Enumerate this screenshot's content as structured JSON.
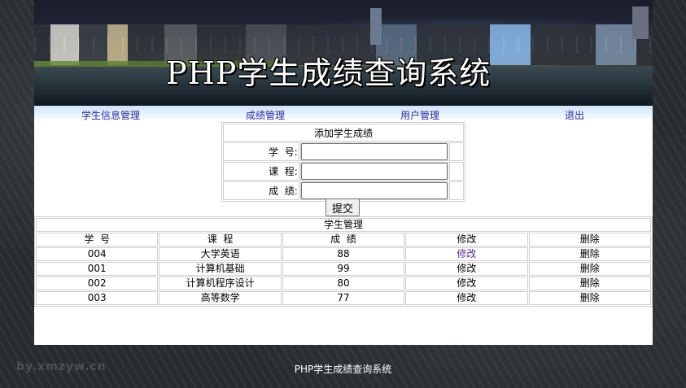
{
  "banner": {
    "title": "PHP学生成绩查询系统"
  },
  "nav": [
    {
      "label": "学生信息管理"
    },
    {
      "label": "成绩管理"
    },
    {
      "label": "用户管理"
    },
    {
      "label": "退出"
    }
  ],
  "form": {
    "caption": "添加学生成绩",
    "fields": [
      {
        "label": "学  号:",
        "value": ""
      },
      {
        "label": "课  程:",
        "value": ""
      },
      {
        "label": "成  绩:",
        "value": ""
      }
    ],
    "submit_label": "提交"
  },
  "table": {
    "caption": "学生管理",
    "headers": [
      "学  号",
      "课  程",
      "成  绩",
      "修改",
      "删除"
    ],
    "rows": [
      {
        "id": "004",
        "course": "大学英语",
        "score": "88",
        "edit": "修改",
        "delete": "删除"
      },
      {
        "id": "001",
        "course": "计算机基础",
        "score": "99",
        "edit": "修改",
        "delete": "删除"
      },
      {
        "id": "002",
        "course": "计算机程序设计",
        "score": "80",
        "edit": "修改",
        "delete": "删除"
      },
      {
        "id": "003",
        "course": "高等数学",
        "score": "77",
        "edit": "修改",
        "delete": "删除"
      }
    ]
  },
  "footer": {
    "text": "PHP学生成绩查询系统",
    "watermark": "by.xmzyw.cn"
  }
}
